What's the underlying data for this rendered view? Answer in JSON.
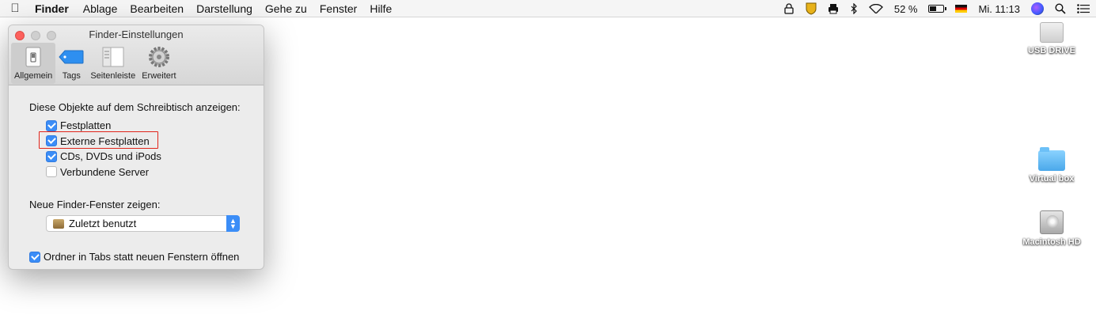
{
  "menubar": {
    "app_name": "Finder",
    "items": [
      "Ablage",
      "Bearbeiten",
      "Darstellung",
      "Gehe zu",
      "Fenster",
      "Hilfe"
    ],
    "battery_percent": "52 %",
    "clock": "Mi. 11:13"
  },
  "window": {
    "title": "Finder-Einstellungen",
    "tabs": [
      {
        "label": "Allgemein",
        "icon": "switch-icon",
        "active": true
      },
      {
        "label": "Tags",
        "icon": "tag-icon",
        "active": false
      },
      {
        "label": "Seitenleiste",
        "icon": "sidebar-icon",
        "active": false
      },
      {
        "label": "Erweitert",
        "icon": "gear-icon",
        "active": false
      }
    ],
    "desktop_heading": "Diese Objekte auf dem Schreibtisch anzeigen:",
    "desktop_items": [
      {
        "label": "Festplatten",
        "checked": true
      },
      {
        "label": "Externe Festplatten",
        "checked": true
      },
      {
        "label": "CDs, DVDs und iPods",
        "checked": true
      },
      {
        "label": "Verbundene Server",
        "checked": false
      }
    ],
    "new_window_heading": "Neue Finder-Fenster zeigen:",
    "new_window_value": "Zuletzt benutzt",
    "tabs_option": {
      "label": "Ordner in Tabs statt neuen Fenstern öffnen",
      "checked": true
    }
  },
  "desktop": {
    "icons": [
      {
        "label": "USB DRIVE",
        "icon": "usb-drive-icon"
      },
      {
        "label": "Virtual box",
        "icon": "folder-icon"
      },
      {
        "label": "Macintosh HD",
        "icon": "hard-drive-icon"
      }
    ]
  },
  "colors": {
    "accent": "#3b8df7",
    "highlight": "#e1251b"
  }
}
